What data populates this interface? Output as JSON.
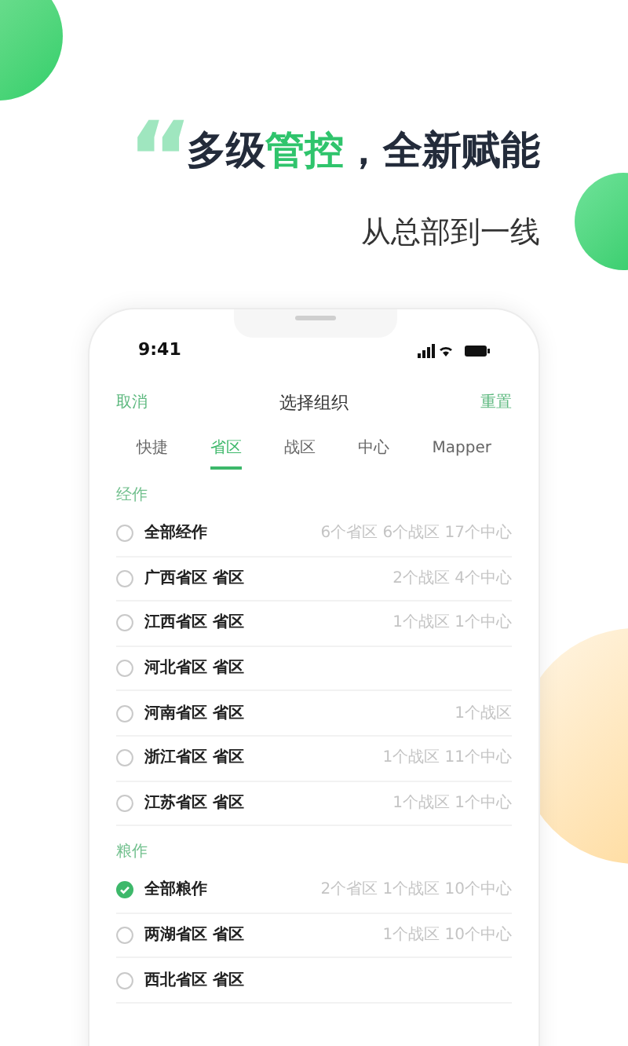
{
  "headline": {
    "quote_mark": "“",
    "parts": [
      {
        "text": "多级",
        "accent": false
      },
      {
        "text": "管控",
        "accent": true
      },
      {
        "text": "，全新赋能",
        "accent": false
      }
    ]
  },
  "subtitle": "从总部到一线",
  "phone": {
    "status_bar": {
      "time": "9:41"
    },
    "nav": {
      "left": "取消",
      "title": "选择组织",
      "right": "重置"
    },
    "tabs": [
      {
        "label": "快捷",
        "selected": false
      },
      {
        "label": "省区",
        "selected": true
      },
      {
        "label": "战区",
        "selected": false
      },
      {
        "label": "中心",
        "selected": false
      },
      {
        "label": "Mapper",
        "selected": false
      }
    ],
    "sections": [
      {
        "title": "经作",
        "rows": [
          {
            "name": "全部经作",
            "summary": "6个省区 6个战区 17个中心",
            "selected": false
          },
          {
            "name": "广西省区 省区",
            "summary": "2个战区 4个中心",
            "selected": false
          },
          {
            "name": "江西省区 省区",
            "summary": "1个战区 1个中心",
            "selected": false
          },
          {
            "name": "河北省区 省区",
            "selected": false
          },
          {
            "name": "河南省区 省区",
            "summary": "1个战区",
            "selected": false
          },
          {
            "name": "浙江省区 省区",
            "summary": "1个战区 11个中心",
            "selected": false
          },
          {
            "name": "江苏省区 省区",
            "summary": "1个战区 1个中心",
            "selected": false
          }
        ]
      },
      {
        "title": "粮作",
        "rows": [
          {
            "name": "全部粮作",
            "summary": "2个省区 1个战区 10个中心",
            "selected": true
          },
          {
            "name": "两湖省区 省区",
            "summary": "1个战区 10个中心",
            "selected": false
          },
          {
            "name": "西北省区 省区",
            "selected": false
          }
        ]
      }
    ]
  }
}
